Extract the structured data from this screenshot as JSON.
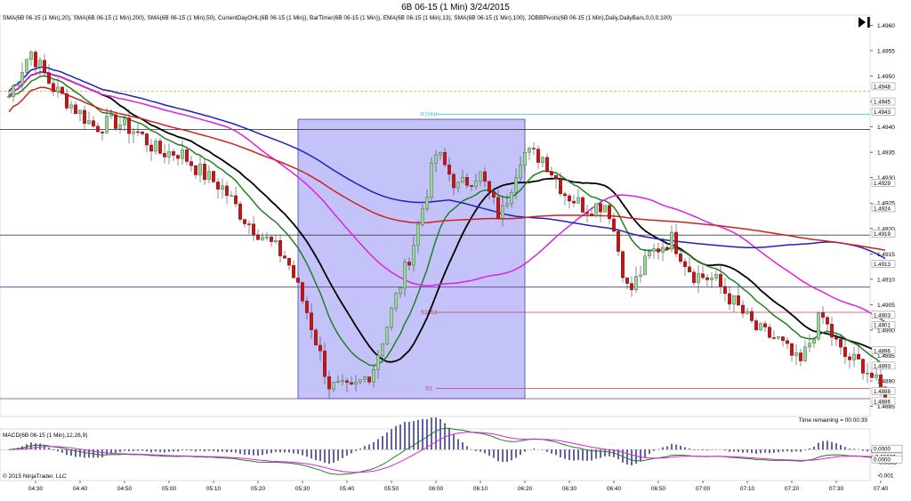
{
  "window": {
    "title": "6B 06-15 (1 Min)  3/24/2015"
  },
  "header": {
    "indicators_line": "SMA(6B 06-15 (1 Min),20), SMA(6B 06-15 (1 Min),200), SMA(6B 06-15 (1 Min),50), CurrentDayOHL(6B 06-15 (1 Min)), BarTimer(6B 06-15 (1 Min)), EMA(6B 06-15 (1 Min),13), SMA(6B 06-15 (1 Min),100), JOBBPivots(6B 06-15 (1 Min),Daily,DailyBars,0,0,0,100)"
  },
  "footer": {
    "time_remaining": "Time remaining = 00:00:39",
    "copyright": "© 2015 NinjaTrader, LLC",
    "macd_label": "MACD(6B 06-15 (1 Min),12,26,9)"
  },
  "chart_data": {
    "type": "candlestick",
    "symbol": "6B 06-15",
    "interval": "1 Min",
    "date": "3/24/2015",
    "x_ticks": [
      "04:30",
      "04:40",
      "04:50",
      "05:00",
      "05:10",
      "05:20",
      "05:30",
      "05:40",
      "05:50",
      "06:00",
      "06:10",
      "06:20",
      "06:30",
      "06:40",
      "06:50",
      "07:00",
      "07:10",
      "07:20",
      "07:30",
      "07:40"
    ],
    "y_ticks": [
      "1.4960",
      "1.4955",
      "1.4950",
      "1.4945",
      "1.4940",
      "1.4935",
      "1.4930",
      "1.4925",
      "1.4920",
      "1.4915",
      "1.4910",
      "1.4905",
      "1.4900",
      "1.4895",
      "1.4890",
      "1.4885"
    ],
    "ylim": [
      1.4883,
      1.4962
    ],
    "pivot_levels": [
      {
        "label": "R1Mid",
        "value": 1.49425,
        "color": "#40c8d8"
      },
      {
        "label": "S1Mid",
        "value": 1.49035,
        "color": "#c04060"
      },
      {
        "label": "S1",
        "value": 1.48885,
        "color": "#c04060"
      }
    ],
    "horizontal_lines": [
      {
        "value": 1.4947,
        "color": "#f0a020",
        "style": "dashed"
      },
      {
        "value": 1.49395,
        "color": "#404040",
        "style": "solid"
      },
      {
        "value": 1.49187,
        "color": "#404040",
        "style": "solid"
      },
      {
        "value": 1.49085,
        "color": "#7040a0",
        "style": "solid"
      },
      {
        "value": 1.48865,
        "color": "#7040a0",
        "style": "solid"
      }
    ],
    "price_tags": [
      "1.4948",
      "1.4945",
      "1.4943",
      "1.4929",
      "1.4924",
      "1.4919",
      "1.4913",
      "1.4903",
      "1.4901",
      "1.4896",
      "1.4893",
      "1.4888",
      "1.4886"
    ],
    "highlight_box": {
      "x_from": "05:29",
      "x_to": "06:20",
      "y_from": 1.48865,
      "y_to": 1.49415,
      "color": "#6060f0"
    },
    "series": [
      {
        "name": "SMA 20",
        "color": "#000000"
      },
      {
        "name": "EMA 13",
        "color": "#208020"
      },
      {
        "name": "SMA 50",
        "color": "#e020e0"
      },
      {
        "name": "SMA 100",
        "color": "#2020c0"
      },
      {
        "name": "SMA 200",
        "color": "#d02020"
      }
    ],
    "key_prices": [
      1.4946,
      1.4955,
      1.4948,
      1.4944,
      1.494,
      1.4941,
      1.4939,
      1.4935,
      1.4935,
      1.4931,
      1.4928,
      1.4922,
      1.4918,
      1.4914,
      1.4903,
      1.4889,
      1.4888,
      1.4892,
      1.4905,
      1.4918,
      1.4935,
      1.4928,
      1.4931,
      1.4922,
      1.4935,
      1.4934,
      1.4927,
      1.4924,
      1.4925,
      1.4907,
      1.4915,
      1.4918,
      1.4911,
      1.491,
      1.4905,
      1.49,
      1.4898,
      1.4893,
      1.4903,
      1.4895,
      1.4893,
      1.4887
    ],
    "macd": {
      "label": "MACD(6B 06-15 (1 Min),12,26,9)",
      "y_ticks": [
        "0.0000",
        "-0.0005",
        "-0.001"
      ],
      "tags": [
        "0.0000",
        "-0.00027",
        "0.0000"
      ],
      "ylim": [
        -0.0012,
        0.0008
      ]
    }
  }
}
